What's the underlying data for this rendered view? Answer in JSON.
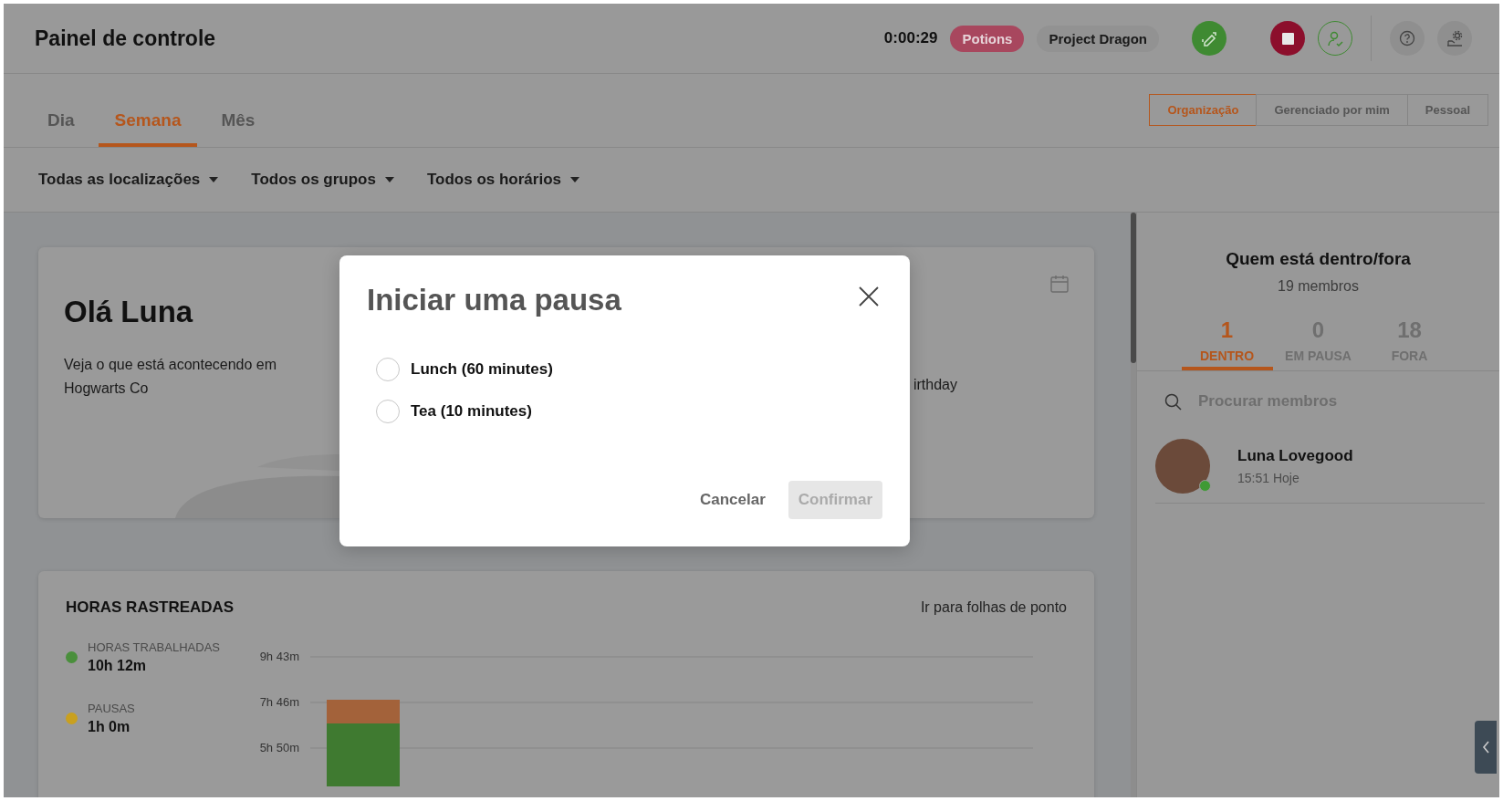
{
  "header": {
    "title": "Painel de controle",
    "timer": "0:00:29",
    "activity": "Potions",
    "project": "Project Dragon"
  },
  "view_tabs": [
    {
      "label": "Dia",
      "selected": false
    },
    {
      "label": "Semana",
      "selected": true
    },
    {
      "label": "Mês",
      "selected": false
    }
  ],
  "scope_tabs": [
    {
      "label": "Organização",
      "selected": true
    },
    {
      "label": "Gerenciado por mim",
      "selected": false
    },
    {
      "label": "Pessoal",
      "selected": false
    }
  ],
  "filters": [
    "Todas as localizações",
    "Todos os grupos",
    "Todos os horários"
  ],
  "greeting": {
    "title": "Olá Luna",
    "text": "Veja o que está acontecendo em Hogwarts Co",
    "event": "irthday"
  },
  "hours_tracked": {
    "title": "HORAS RASTREADAS",
    "link": "Ir para folhas de ponto",
    "legend": [
      {
        "label": "HORAS TRABALHADAS",
        "value": "10h 12m",
        "color": "#4a8f3c"
      },
      {
        "label": "PAUSAS",
        "value": "1h 0m",
        "color": "#c9a01f"
      }
    ],
    "axis_labels": [
      "9h 43m",
      "7h 46m",
      "5h 50m"
    ]
  },
  "who_panel": {
    "title": "Quem está dentro/fora",
    "subtitle": "19 membros",
    "stats": [
      {
        "count": "1",
        "label": "DENTRO",
        "selected": true
      },
      {
        "count": "0",
        "label": "EM PAUSA",
        "selected": false
      },
      {
        "count": "18",
        "label": "FORA",
        "selected": false
      }
    ],
    "search": {
      "placeholder": "Procurar membros"
    },
    "members": [
      {
        "name": "Luna Lovegood",
        "time": "15:51 Hoje",
        "online": true
      }
    ]
  },
  "dialog": {
    "title": "Iniciar uma pausa",
    "options": [
      {
        "label": "Lunch (60 minutes)",
        "selected": false
      },
      {
        "label": "Tea (10 minutes)",
        "selected": false
      }
    ],
    "buttons": [
      {
        "label": "Cancelar",
        "disabled": false
      },
      {
        "label": "Confirmar",
        "disabled": true
      }
    ]
  }
}
